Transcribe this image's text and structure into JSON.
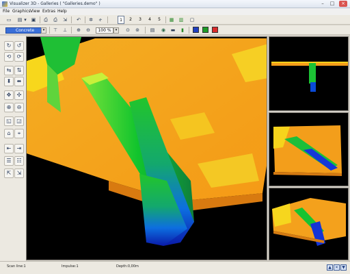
{
  "window": {
    "title": "Visualizer 3D - Galleries ( \"Galleries.demo\" )"
  },
  "menu": {
    "items": [
      "File",
      "Graphics",
      "View",
      "Extras",
      "Help"
    ]
  },
  "toolbar": {
    "view_numbers": [
      "1",
      "2",
      "3",
      "4",
      "5"
    ],
    "active_view": "1"
  },
  "toolbar2": {
    "material": "Concrete",
    "zoom": "100 %",
    "colors": [
      "#1f3fbf",
      "#1e9a28",
      "#d92b2b"
    ]
  },
  "status": {
    "scan_line": "Scan line:1",
    "impulse": "Impulse:1",
    "depth": "Depth:0,00m"
  },
  "colors": {
    "terrain": "#f7a21c",
    "highlight": "#f5d21a",
    "trench_green": "#18c832",
    "trench_blue": "#1432d8",
    "background": "#000000"
  }
}
